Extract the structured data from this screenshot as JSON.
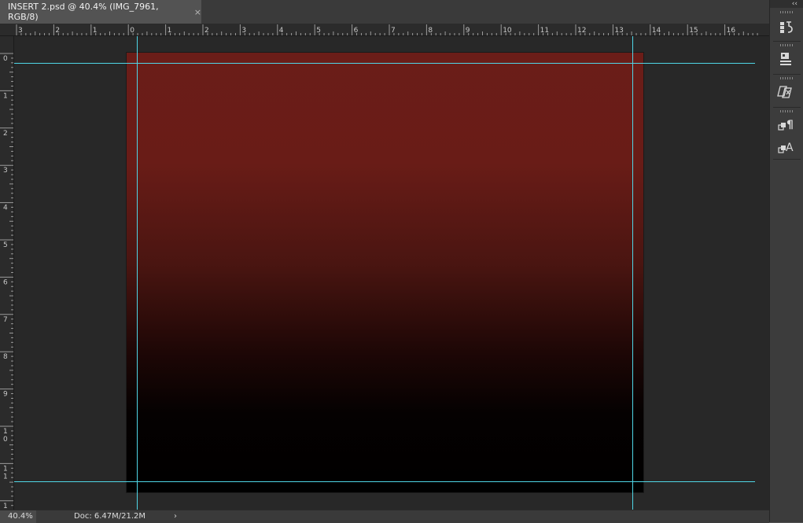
{
  "document_tab": {
    "title": "INSERT 2.psd @ 40.4% (IMG_7961, RGB/8)",
    "close_glyph": "×"
  },
  "rulers": {
    "horizontal_labels": [
      "3",
      "2",
      "1",
      "0",
      "1",
      "2",
      "3",
      "4",
      "5",
      "6",
      "7",
      "8",
      "9",
      "10",
      "11",
      "12",
      "13",
      "14",
      "15",
      "16"
    ],
    "vertical_labels": [
      "0",
      "1",
      "2",
      "3",
      "4",
      "5",
      "6",
      "7",
      "8",
      "9",
      "10",
      "11",
      "1"
    ]
  },
  "status": {
    "zoom": "40.4%",
    "doc_info": "Doc: 6.47M/21.2M",
    "arrow": "›"
  },
  "dock": {
    "collapse_glyph": "‹‹",
    "buttons": [
      {
        "name": "history-panel-button",
        "icon": "history-icon"
      },
      {
        "name": "properties-panel-button",
        "icon": "properties-icon"
      },
      {
        "name": "clone-source-panel-button",
        "icon": "clone-source-icon"
      },
      {
        "name": "paragraph-panel-button",
        "icon": "paragraph-icon"
      },
      {
        "name": "character-panel-button",
        "icon": "character-icon"
      }
    ]
  },
  "colors": {
    "guide": "#4fd6e6",
    "canvas_top": "#6b1d18",
    "canvas_bottom": "#000000"
  }
}
